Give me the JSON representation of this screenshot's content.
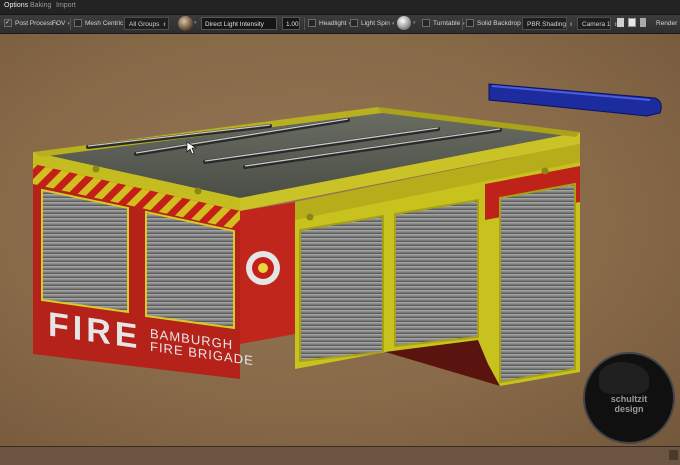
{
  "tabs": [
    {
      "label": "Options",
      "active": true
    },
    {
      "label": "Baking",
      "active": false
    },
    {
      "label": "Import",
      "active": false
    }
  ],
  "toolbar": {
    "post_process": {
      "label": "Post Process",
      "checked": true
    },
    "fov": {
      "label": "FOV"
    },
    "mesh_centric": {
      "label": "Mesh Centric",
      "checked": false
    },
    "groups_select": "All Groups",
    "light_field_value": "Direct Light Intensity",
    "light_value": "1.00",
    "headlight": {
      "label": "Headlight",
      "checked": false
    },
    "light_spin": {
      "label": "Light Spin",
      "checked": false
    },
    "turntable": {
      "label": "Turntable",
      "checked": false
    },
    "solid_backdrop": {
      "label": "Solid Backdrop",
      "checked": false
    },
    "shading_select": "PBR Shading",
    "camera_select": "Camera 1",
    "render_label": "Render"
  },
  "model_text": {
    "fire": "FIRE",
    "brigade_line1": "BAMBURGH",
    "brigade_line2": "FIRE BRIGADE"
  },
  "watermark": {
    "line1": "schultzit",
    "line2": "design"
  },
  "colors": {
    "accent_yellow": "#c8c21e",
    "body_red": "#b8231a",
    "background": "#8a6c4d",
    "light_bar_blue": "#2030a8"
  }
}
